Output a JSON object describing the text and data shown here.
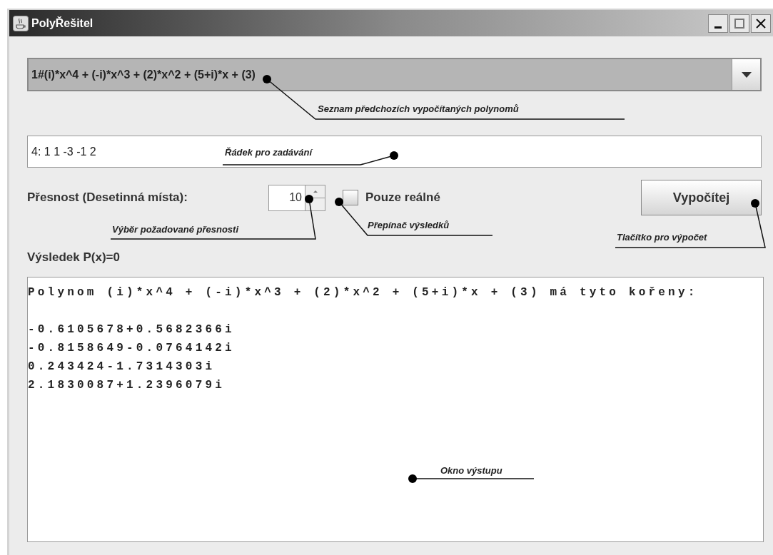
{
  "window": {
    "title": "PolyŘešitel"
  },
  "history_combo": {
    "value": "1#(i)*x^4 + (-i)*x^3 + (2)*x^2 + (5+i)*x + (3)"
  },
  "input_field": {
    "value": "4: 1 1 -3 -1 2"
  },
  "precision": {
    "label": "Přesnost (Desetinná místa):",
    "value": "10"
  },
  "real_only": {
    "label": "Pouze reálné",
    "checked": false
  },
  "compute_button": {
    "label": "Vypočítej"
  },
  "result_label": "Výsledek P(x)=0",
  "output": {
    "header": "Polynom (i)*x^4 + (-i)*x^3 + (2)*x^2 + (5+i)*x + (3) má tyto kořeny:",
    "roots": [
      "-0.6105678+0.5682366i",
      "-0.8158649-0.0764142i",
      "0.243424-1.7314303i",
      "2.1830087+1.2396079i"
    ]
  },
  "annotations": [
    {
      "text": "Seznam předchozích vypočítaných polynomů"
    },
    {
      "text": "Řádek pro zadávání"
    },
    {
      "text": "Výběr požadované přesnosti"
    },
    {
      "text": "Přepínač výsledků"
    },
    {
      "text": "Tlačítko pro výpočet"
    },
    {
      "text": "Okno výstupu"
    }
  ]
}
